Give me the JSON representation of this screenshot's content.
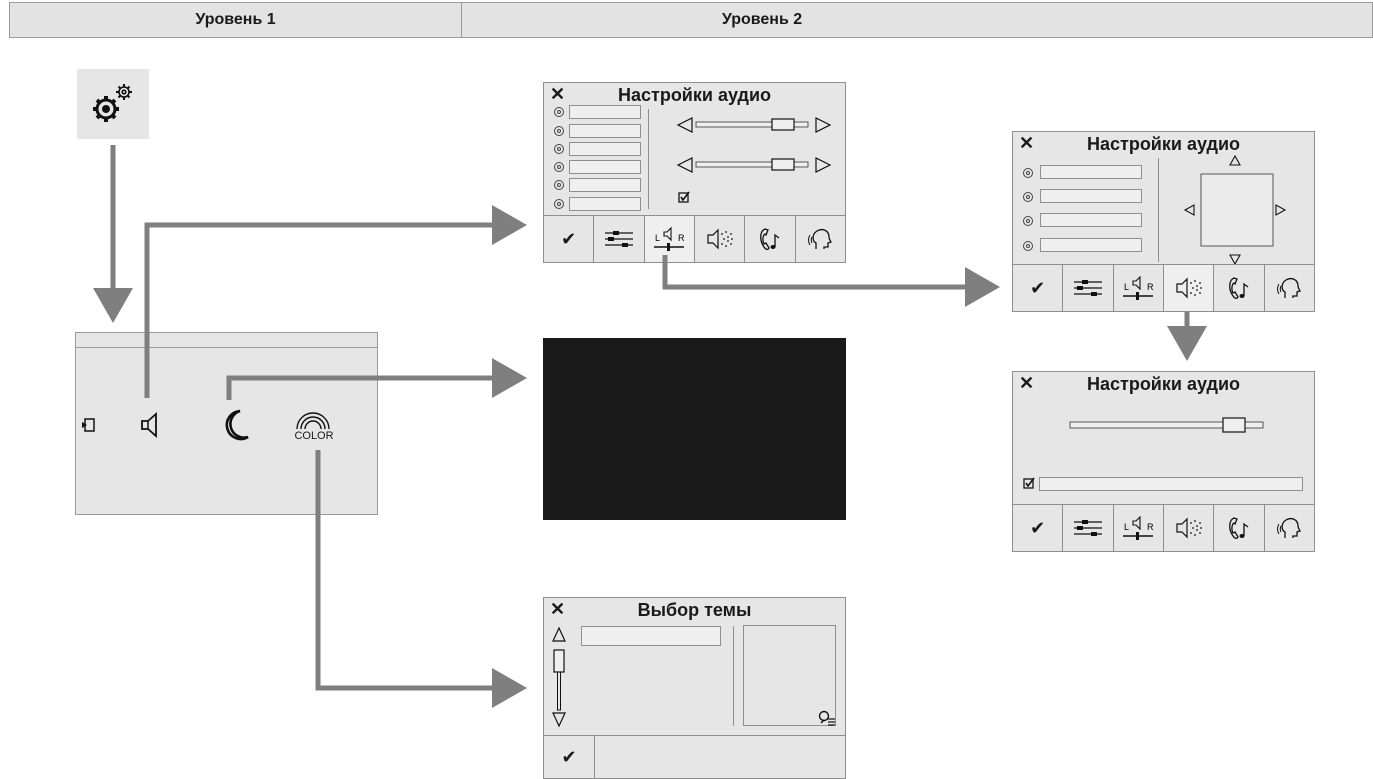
{
  "levels": {
    "level1": "Уровень 1",
    "level2": "Уровень 2"
  },
  "settings_tile": {
    "icon": "settings-gears-icon"
  },
  "main_menu": {
    "items": [
      {
        "icon": "exit-icon"
      },
      {
        "icon": "speaker-icon"
      },
      {
        "icon": "moon-icon"
      },
      {
        "icon": "rainbow-color-icon",
        "label": "COLOR"
      }
    ]
  },
  "audio_panel_1": {
    "close": "✕",
    "title": "Настройки аудио",
    "tabs": [
      {
        "icon": "check-icon",
        "label": "✔"
      },
      {
        "icon": "equalizer-icon"
      },
      {
        "icon": "balance-lr-icon",
        "left": "L",
        "right": "R"
      },
      {
        "icon": "surround-speaker-icon"
      },
      {
        "icon": "phone-music-icon"
      },
      {
        "icon": "voice-icon"
      }
    ]
  },
  "audio_panel_2": {
    "close": "✕",
    "title": "Настройки аудио",
    "balance_left": "L",
    "balance_right": "R"
  },
  "audio_panel_3": {
    "close": "✕",
    "title": "Настройки аудио",
    "balance_left": "L",
    "balance_right": "R"
  },
  "theme_panel": {
    "close": "✕",
    "title": "Выбор темы",
    "confirm": "✔"
  },
  "colors": {
    "panel_bg": "#e6e6e6",
    "arrow": "#7f7f7f",
    "dark_screen": "#1a1a1a"
  }
}
